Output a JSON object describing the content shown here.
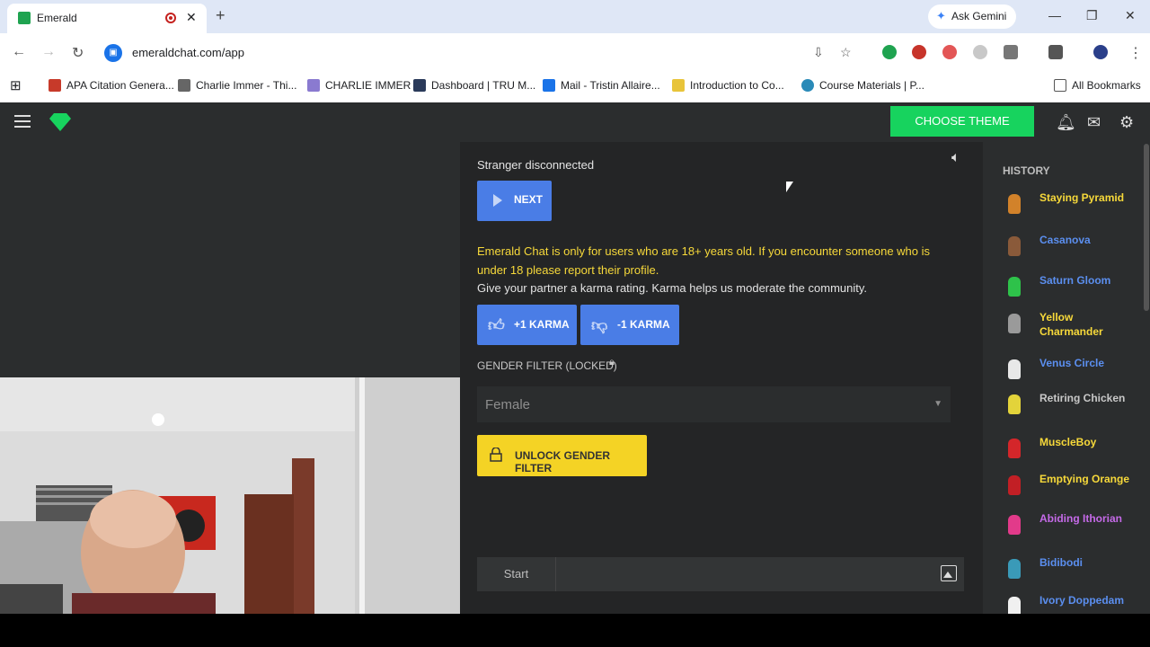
{
  "browser": {
    "tab_title": "Emerald",
    "gemini_label": "Ask Gemini",
    "url": "emeraldchat.com/app",
    "bookmarks": [
      "APA Citation Genera...",
      "Charlie Immer - Thi...",
      "CHARLIE IMMER",
      "Dashboard | TRU M...",
      "Mail - Tristin Allaire...",
      "Introduction to Co...",
      "Course Materials | P..."
    ],
    "all_bookmarks": "All Bookmarks"
  },
  "app": {
    "theme_button": "CHOOSE THEME",
    "status": "Stranger disconnected",
    "next_button": "NEXT",
    "warning": "Emerald Chat is only for users who are 18+ years old. If you encounter someone who is under 18 please report their profile.",
    "karma_text": "Give your partner a karma rating. Karma helps us moderate the community.",
    "karma_plus": "+1 KARMA",
    "karma_minus": "-1 KARMA",
    "gender_filter_label": "GENDER FILTER (LOCKED)",
    "gender_select_value": "Female",
    "unlock_button": "UNLOCK GENDER FILTER",
    "start_button": "Start"
  },
  "history": {
    "title": "HISTORY",
    "items": [
      {
        "name": "Staying Pyramid",
        "color": "#f7d93a",
        "avatar": "#d2822a"
      },
      {
        "name": "Casanova",
        "color": "#5b8ff0",
        "avatar": "#8a5a3a"
      },
      {
        "name": "Saturn Gloom",
        "color": "#5b8ff0",
        "avatar": "#2ec24a"
      },
      {
        "name": "Yellow Charmander",
        "color": "#f7d93a",
        "avatar": "#9a9a9a"
      },
      {
        "name": "Venus Circle",
        "color": "#5b8ff0",
        "avatar": "#e8e8e8"
      },
      {
        "name": "Retiring Chicken",
        "color": "#c8c8c8",
        "avatar": "#e3d33a"
      },
      {
        "name": "MuscleBoy",
        "color": "#f7d93a",
        "avatar": "#d4262a"
      },
      {
        "name": "Emptying Orange",
        "color": "#f7d93a",
        "avatar": "#c21f25"
      },
      {
        "name": "Abiding Ithorian",
        "color": "#c56ae8",
        "avatar": "#e23a8a"
      },
      {
        "name": "Bidibodi",
        "color": "#5b8ff0",
        "avatar": "#3a9ab8"
      },
      {
        "name": "Ivory Doppedam",
        "color": "#5b8ff0",
        "avatar": "#f0f0f0"
      }
    ]
  }
}
